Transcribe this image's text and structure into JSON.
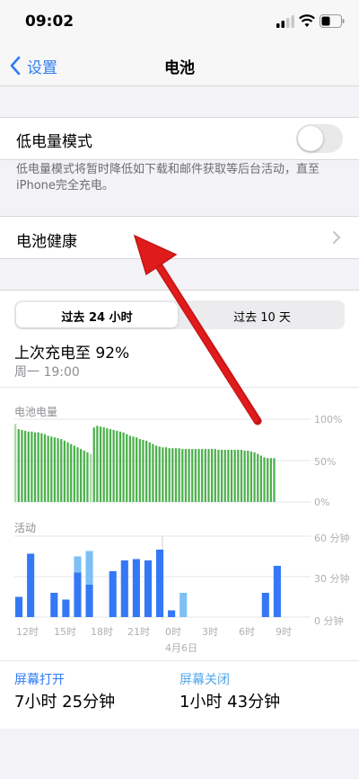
{
  "status_bar": {
    "time": "09:02"
  },
  "nav": {
    "back_label": "设置",
    "title": "电池"
  },
  "low_power": {
    "label": "低电量模式",
    "enabled": false,
    "footnote": "低电量模式将暂时降低如下载和邮件获取等后台活动，直至iPhone完全充电。"
  },
  "battery_health": {
    "label": "电池健康"
  },
  "segments": {
    "options": [
      "过去 24 小时",
      "过去 10 天"
    ],
    "selected": 0
  },
  "last_charge": {
    "title": "上次充电至 92%",
    "time": "周一 19:00"
  },
  "battery_level": {
    "label": "电池电量",
    "y_ticks": [
      "100%",
      "50%",
      "0%"
    ]
  },
  "activity": {
    "label": "活动",
    "y_ticks": [
      "60 分钟",
      "30 分钟",
      "0 分钟"
    ],
    "x_ticks": [
      "12时",
      "15时",
      "18时",
      "21时",
      "0时",
      "3时",
      "6时",
      "9时"
    ],
    "date_label": "4月6日"
  },
  "screen_on": {
    "label": "屏幕打开",
    "value": "7小时 25分钟"
  },
  "screen_off": {
    "label": "屏幕关闭",
    "value": "1小时 43分钟"
  },
  "colors": {
    "accent": "#2f7cf6",
    "battery_green": "#4cb04c",
    "screen_on_blue": "#3478f6",
    "screen_off_blue": "#7ec0f5",
    "annotation_red": "#e01b1b"
  },
  "chart_data": [
    {
      "type": "bar",
      "title": "电池电量",
      "ylim": [
        0,
        100
      ],
      "y_ticks": [
        "0%",
        "50%",
        "100%"
      ],
      "values": [
        94,
        88,
        87,
        86,
        85,
        85,
        84,
        84,
        83,
        82,
        80,
        79,
        78,
        77,
        76,
        74,
        72,
        70,
        68,
        66,
        64,
        62,
        60,
        58,
        90,
        92,
        91,
        90,
        89,
        88,
        87,
        86,
        85,
        84,
        82,
        80,
        79,
        78,
        76,
        75,
        74,
        72,
        70,
        68,
        67,
        66,
        66,
        65,
        65,
        65,
        65,
        64,
        64,
        64,
        64,
        64,
        64,
        64,
        64,
        64,
        64,
        64,
        63,
        63,
        63,
        63,
        63,
        63,
        63,
        63,
        62,
        62,
        61,
        60,
        58,
        56,
        54,
        53,
        53,
        53
      ],
      "charging_at_index": [
        0,
        23
      ]
    },
    {
      "type": "bar",
      "title": "活动",
      "ylim": [
        0,
        60
      ],
      "categories": [
        "12时",
        "",
        "",
        "15时",
        "",
        "",
        "18时",
        "",
        "",
        "21时",
        "",
        "",
        "0时",
        "",
        "",
        "3时",
        "",
        "",
        "6时",
        "",
        "",
        "9时"
      ],
      "series": [
        {
          "name": "屏幕打开",
          "values": [
            15,
            47,
            0,
            18,
            13,
            33,
            24,
            0,
            34,
            42,
            43,
            42,
            50,
            5,
            0,
            0,
            0,
            0,
            0,
            0,
            0,
            18,
            38,
            0
          ]
        },
        {
          "name": "屏幕关闭",
          "values": [
            0,
            0,
            0,
            0,
            0,
            12,
            25,
            0,
            0,
            0,
            0,
            0,
            0,
            0,
            18,
            0,
            0,
            0,
            0,
            0,
            0,
            0,
            0,
            0
          ]
        }
      ]
    }
  ],
  "annotation": {
    "type": "arrow",
    "color": "#e01b1b"
  }
}
